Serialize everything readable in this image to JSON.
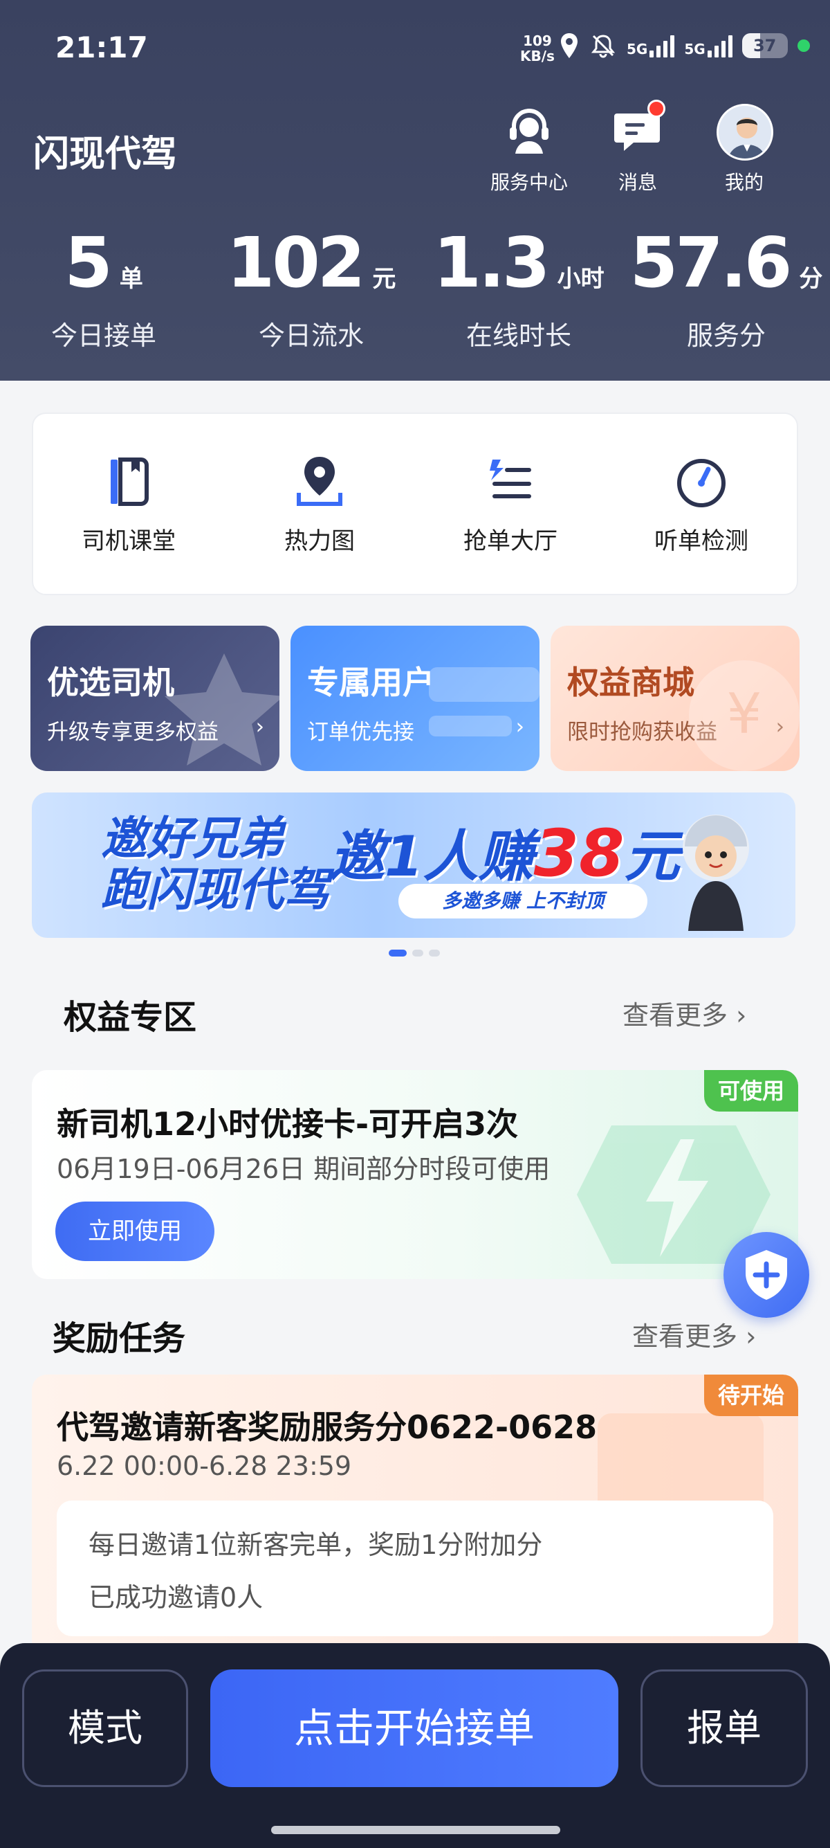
{
  "status_bar": {
    "time": "21:17",
    "net_speed_value": "109",
    "net_speed_unit": "KB/s",
    "sim1": "5G",
    "sim2": "5G",
    "battery": "37"
  },
  "header": {
    "app_title": "闪现代驾",
    "buttons": [
      {
        "label": "服务中心",
        "icon": "headset-icon"
      },
      {
        "label": "消息",
        "icon": "message-icon"
      },
      {
        "label": "我的",
        "icon": "avatar"
      }
    ]
  },
  "stats": [
    {
      "value": "5",
      "unit": "单",
      "label": "今日接单"
    },
    {
      "value": "102",
      "unit": "元",
      "label": "今日流水"
    },
    {
      "value": "1.3",
      "unit": "小时",
      "label": "在线时长"
    },
    {
      "value": "57.6",
      "unit": "分",
      "label": "服务分"
    }
  ],
  "tools": [
    {
      "label": "司机课堂",
      "icon": "book-icon"
    },
    {
      "label": "热力图",
      "icon": "map-pin-icon"
    },
    {
      "label": "抢单大厅",
      "icon": "list-icon"
    },
    {
      "label": "听单检测",
      "icon": "gauge-icon"
    }
  ],
  "promos": [
    {
      "title": "优选司机",
      "subtitle": "升级专享更多权益"
    },
    {
      "title": "专属用户",
      "subtitle": "订单优先接"
    },
    {
      "title": "权益商城",
      "subtitle": "限时抢购获收益"
    }
  ],
  "banner": {
    "left_line1": "邀好兄弟",
    "left_line2": "跑闪现代驾",
    "main_prefix": "邀1人赚",
    "main_amount": "38",
    "main_suffix": "元",
    "sub": "多邀多赚 上不封顶"
  },
  "benefits_section": {
    "title": "权益专区",
    "more": "查看更多",
    "card": {
      "tag": "可使用",
      "title": "新司机12小时优接卡-可开启3次",
      "date": "06月19日-06月26日 期间部分时段可使用",
      "button": "立即使用"
    }
  },
  "tasks_section": {
    "title": "奖励任务",
    "more": "查看更多",
    "card": {
      "tag": "待开始",
      "title": "代驾邀请新客奖励服务分0622-0628",
      "date": "6.22 00:00-6.28 23:59",
      "line1": "每日邀请1位新客完单，奖励1分附加分",
      "line2": "已成功邀请0人"
    }
  },
  "bottom_bar": {
    "mode": "模式",
    "start": "点击开始接单",
    "report": "报单"
  },
  "colors": {
    "header_bg": "#3a4260",
    "primary_blue": "#3f6cf3",
    "tag_green": "#4ec24e",
    "tag_orange": "#f08a3a",
    "bottom_bg": "#1b2033"
  }
}
